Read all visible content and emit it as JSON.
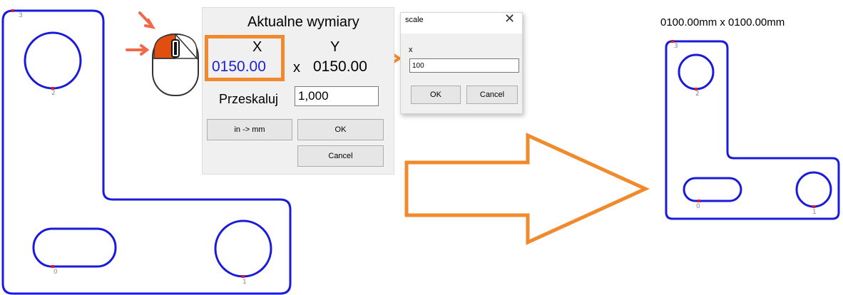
{
  "dimension_dialog": {
    "title": "Aktualne wymiary",
    "x_label": "X",
    "y_label": "Y",
    "x_value": "0150.00",
    "times": "x",
    "y_value": "0150.00",
    "scale_label": "Przeskaluj",
    "scale_value": "1,000",
    "in_mm_label": "in -> mm",
    "ok_label": "OK",
    "cancel_label": "Cancel"
  },
  "scale_dialog": {
    "title": "scale",
    "close_icon": "close-icon",
    "field_label": "x",
    "field_value": "100",
    "ok_label": "OK",
    "cancel_label": "Cancel"
  },
  "result": {
    "dimensions": "0100.00mm x  0100.00mm"
  },
  "left_shape_points": [
    "3",
    "2",
    "0",
    "1"
  ],
  "right_shape_points": [
    "3",
    "2",
    "0",
    "1"
  ],
  "colors": {
    "outline": "#1a1adb",
    "accent_orange": "#f08a2c",
    "x_value_blue": "#1f1fd0",
    "marker_red": "#e02020"
  }
}
